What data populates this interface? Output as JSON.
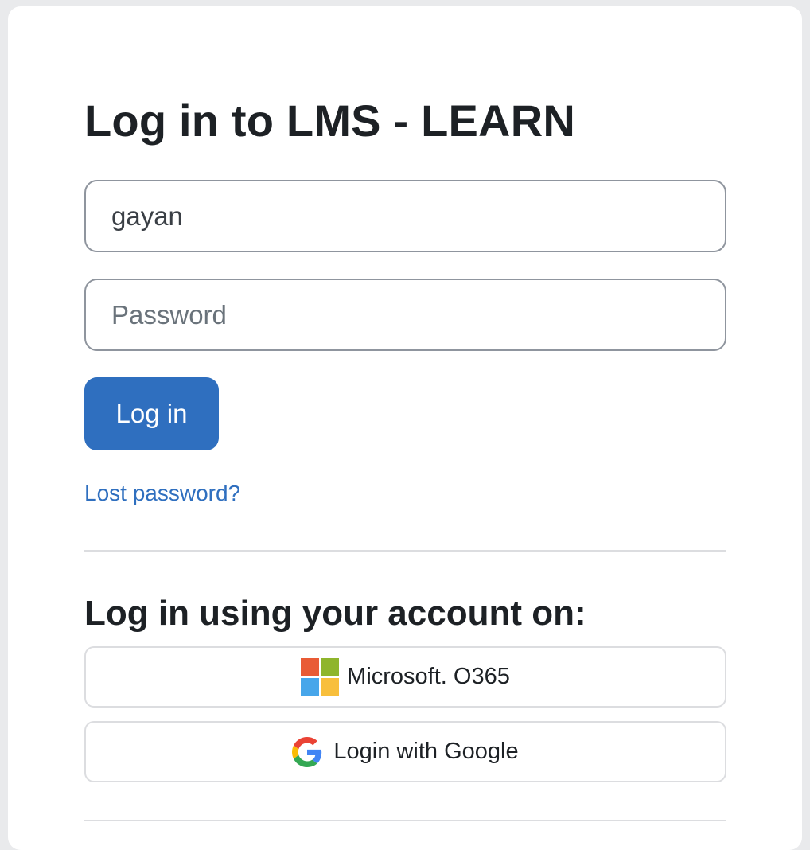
{
  "page": {
    "title": "Log in to LMS - LEARN"
  },
  "form": {
    "username_value": "gayan",
    "password_placeholder": "Password",
    "login_label": "Log in",
    "lost_password_label": "Lost password?"
  },
  "idp": {
    "heading": "Log in using your account on:",
    "microsoft_label": "Microsoft. O365",
    "google_label": "Login with Google"
  },
  "colors": {
    "accent": "#2f6fbf",
    "ms_red": "#f25022",
    "ms_green": "#7fba00",
    "ms_blue": "#00a4ef",
    "ms_yellow": "#ffb900"
  },
  "icons": [
    "microsoft-logo-icon",
    "google-logo-icon"
  ]
}
